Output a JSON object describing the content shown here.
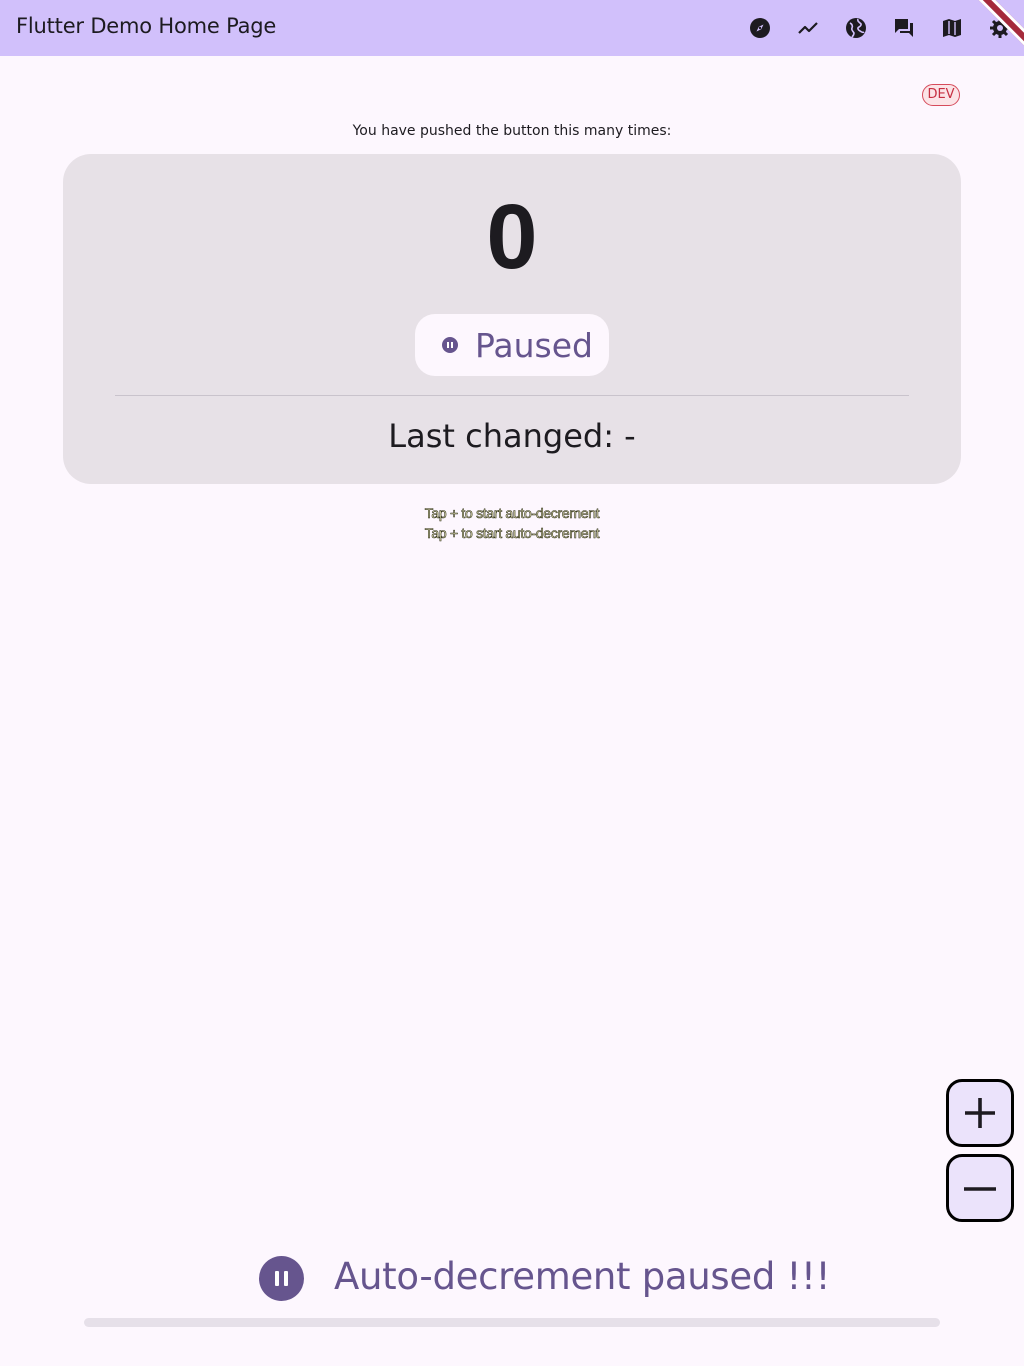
{
  "appbar": {
    "title": "Flutter Demo Home Page",
    "background": "#d1c0fb",
    "actions": [
      {
        "icon": "compass-icon",
        "interactable": true
      },
      {
        "icon": "trending-icon",
        "interactable": true
      },
      {
        "icon": "globe-icon",
        "interactable": true
      },
      {
        "icon": "forum-icon",
        "interactable": true
      },
      {
        "icon": "map-icon",
        "interactable": true
      },
      {
        "icon": "settings-icon",
        "interactable": true
      }
    ],
    "debug_banner": "DEBUG"
  },
  "env_badge": "DEV",
  "pushed_label": "You have pushed the button this many times:",
  "counter": {
    "value": "0",
    "status": "Paused",
    "status_icon": "pause-dot-icon",
    "last_changed": "Last changed: -"
  },
  "hints": [
    "Tap + to start auto-decrement",
    "Tap + to start auto-decrement"
  ],
  "fabs": {
    "increment": {
      "icon": "plus-icon"
    },
    "decrement": {
      "icon": "minus-icon"
    }
  },
  "auto_status": {
    "icon": "pause-icon",
    "text": "Auto-decrement paused !!!",
    "progress": 0
  },
  "colors": {
    "accent": "#66558e",
    "background": "#fdf7fe",
    "card": "#e7e1e7",
    "badge_red": "#c62f42"
  }
}
